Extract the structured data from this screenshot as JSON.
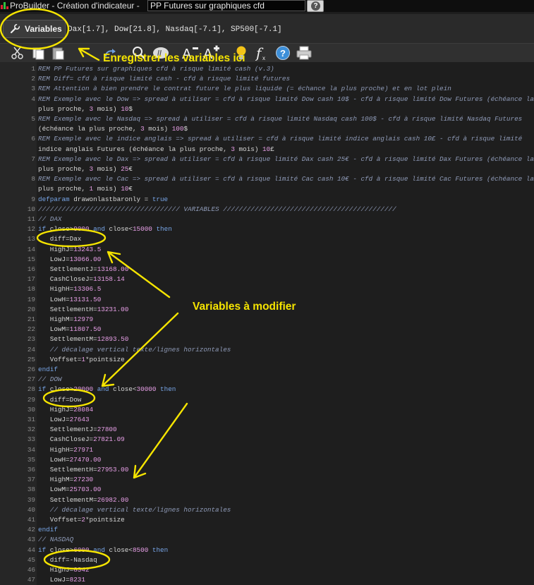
{
  "window": {
    "title": "ProBuilder - Création d'indicateur -",
    "name_value": "PP Futures sur graphiques cfd"
  },
  "variables_bar": {
    "tab_label": "Variables",
    "list": "Dax[1.7], Dow[21.8], Nasdaq[-7.1], SP500[-7.1]"
  },
  "toolbar": {
    "icons": [
      "cut-icon",
      "copy-icon",
      "paste-icon",
      "redo-icon",
      "search-icon",
      "comment-icon",
      "decrease-font-icon",
      "increase-font-icon",
      "lightbulb-icon",
      "function-icon",
      "help-icon",
      "print-icon"
    ]
  },
  "annotations": {
    "save_hint": "Enregistrer les variables ici",
    "modify_hint": "Variables à modifier",
    "color": "#f5e400"
  },
  "colors": {
    "comment": "#8f9bb8",
    "keyword": "#78a6e8",
    "number": "#e8a0e8",
    "text": "#d6d6d6"
  },
  "code_lines": [
    {
      "n": "1",
      "t": "REM PP Futures sur graphiques cfd à risque limité cash (v.3)"
    },
    {
      "n": "2",
      "t": "REM Diff= cfd à risque limité cash - cfd à risque limité futures"
    },
    {
      "n": "3",
      "t": "REM Attention à bien prendre le contrat future le plus liquide (= échance la plus proche) et en lot plein"
    },
    {
      "n": "4",
      "t": "REM Exemple avec le Dow => spread à utiliser = cfd à risque limité Dow cash 10$ - cfd à risque limité Dow Futures (échéance la"
    },
    {
      "n": "",
      "t": "plus proche, 3 mois) 10$"
    },
    {
      "n": "5",
      "t": "REM Exemple avec le Nasdaq => spread à utiliser = cfd à risque limité Nasdaq cash 100$ - cfd à risque limité Nasdaq Futures"
    },
    {
      "n": "",
      "t": "(échéance la plus proche, 3 mois) 100$"
    },
    {
      "n": "6",
      "t": "REM Exemple avec le indice anglais => spread à utiliser = cfd à risque limité indice anglais cash 10£ - cfd à risque limité"
    },
    {
      "n": "",
      "t": "indice anglais Futures (échéance la plus proche, 3 mois) 10£"
    },
    {
      "n": "7",
      "t": "REM Exemple avec le Dax => spread à utiliser = cfd à risque limité Dax cash 25€ - cfd à risque limité Dax Futures (échéance la"
    },
    {
      "n": "",
      "t": "plus proche, 3 mois) 25€"
    },
    {
      "n": "8",
      "t": "REM Exemple avec le Cac => spread à utiliser = cfd à risque limité Cac cash 10€ - cfd à risque limité Cac Futures (échéance la"
    },
    {
      "n": "",
      "t": "plus proche, 1 mois) 10€"
    },
    {
      "n": "9",
      "t": "defparam drawonlastbaronly = true"
    },
    {
      "n": "10",
      "t": "//////////////////////////////////// VARIABLES ////////////////////////////////////////////"
    },
    {
      "n": "11",
      "t": "// DAX"
    },
    {
      "n": "12",
      "t": "if close>9000 and close<15000 then"
    },
    {
      "n": "13",
      "t": "   diff=Dax"
    },
    {
      "n": "14",
      "t": "   HighJ=13243.5"
    },
    {
      "n": "15",
      "t": "   LowJ=13066.00"
    },
    {
      "n": "16",
      "t": "   SettlementJ=13168.00"
    },
    {
      "n": "17",
      "t": "   CashCloseJ=13158.14"
    },
    {
      "n": "18",
      "t": "   HighH=13306.5"
    },
    {
      "n": "19",
      "t": "   LowH=13131.50"
    },
    {
      "n": "20",
      "t": "   SettlementH=13231.00"
    },
    {
      "n": "21",
      "t": "   HighM=12979"
    },
    {
      "n": "22",
      "t": "   LowM=11807.50"
    },
    {
      "n": "23",
      "t": "   SettlementM=12893.50"
    },
    {
      "n": "24",
      "t": "   // décalage vertical texte/lignes horizontales"
    },
    {
      "n": "25",
      "t": "   Voffset=1*pointsize"
    },
    {
      "n": "26",
      "t": "endif"
    },
    {
      "n": "27",
      "t": "// DOW"
    },
    {
      "n": "28",
      "t": "if close>20000 and close<30000 then"
    },
    {
      "n": "29",
      "t": "   diff=Dow"
    },
    {
      "n": "30",
      "t": "   HighJ=28084"
    },
    {
      "n": "31",
      "t": "   LowJ=27643"
    },
    {
      "n": "32",
      "t": "   SettlementJ=27800"
    },
    {
      "n": "33",
      "t": "   CashCloseJ=27821.09"
    },
    {
      "n": "34",
      "t": "   HighH=27971"
    },
    {
      "n": "35",
      "t": "   LowH=27470.00"
    },
    {
      "n": "36",
      "t": "   SettlementH=27953.00"
    },
    {
      "n": "37",
      "t": "   HighM=27230"
    },
    {
      "n": "38",
      "t": "   LowM=25703.00"
    },
    {
      "n": "39",
      "t": "   SettlementM=26982.00"
    },
    {
      "n": "40",
      "t": "   // décalage vertical texte/lignes horizontales"
    },
    {
      "n": "41",
      "t": "   Voffset=2*pointsize"
    },
    {
      "n": "42",
      "t": "endif"
    },
    {
      "n": "43",
      "t": "// NASDAQ"
    },
    {
      "n": "44",
      "t": "if close>6000 and close<8500 then"
    },
    {
      "n": "45",
      "t": "   diff=-Nasdaq"
    },
    {
      "n": "46",
      "t": "   HighJ=8342"
    },
    {
      "n": "47",
      "t": "   LowJ=8231"
    }
  ]
}
